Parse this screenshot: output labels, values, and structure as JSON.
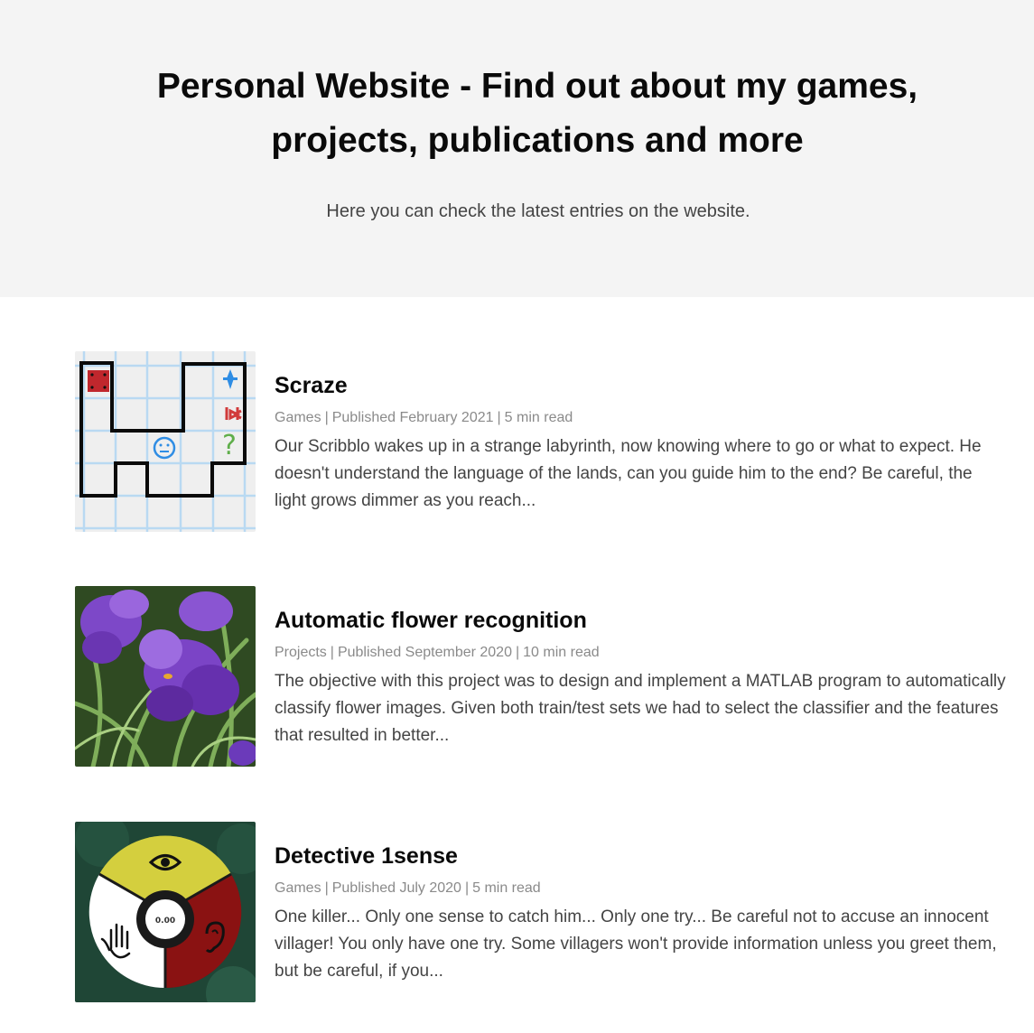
{
  "hero": {
    "title": "Personal Website - Find out about my games, projects, publications and more",
    "subtitle": "Here you can check the latest entries on the website."
  },
  "posts": [
    {
      "title": "Scraze",
      "category": "Games",
      "published": "Published February 2021",
      "read_time": "5 min read",
      "excerpt": "Our Scribblo wakes up in a strange labyrinth, now knowing where to go or what to expect. He doesn't understand the language of the lands, can you guide him to the end? Be careful, the light grows dimmer as you reach...",
      "thumbnail": "maze-game-thumbnail"
    },
    {
      "title": "Automatic flower recognition",
      "category": "Projects",
      "published": "Published September 2020",
      "read_time": "10 min read",
      "excerpt": "The objective with this project was to design and implement a MATLAB program to automatically classify flower images. Given both train/test sets we had to select the classifier and the features that resulted in better...",
      "thumbnail": "crocus-flower-photo"
    },
    {
      "title": "Detective 1sense",
      "category": "Games",
      "published": "Published July 2020",
      "read_time": "5 min read",
      "excerpt": "One killer... Only one sense to catch him... Only one try... Be careful not to accuse an innocent villager! You only have one try. Some villagers won't provide information unless you greet them, but be careful, if you...",
      "thumbnail": "sense-wheel-thumbnail",
      "thumbnail_text": "0.00"
    }
  ],
  "separator": "|",
  "colors": {
    "hero_bg": "#f4f4f4",
    "meta_text": "#8a8a8a",
    "body_text": "#444444"
  }
}
